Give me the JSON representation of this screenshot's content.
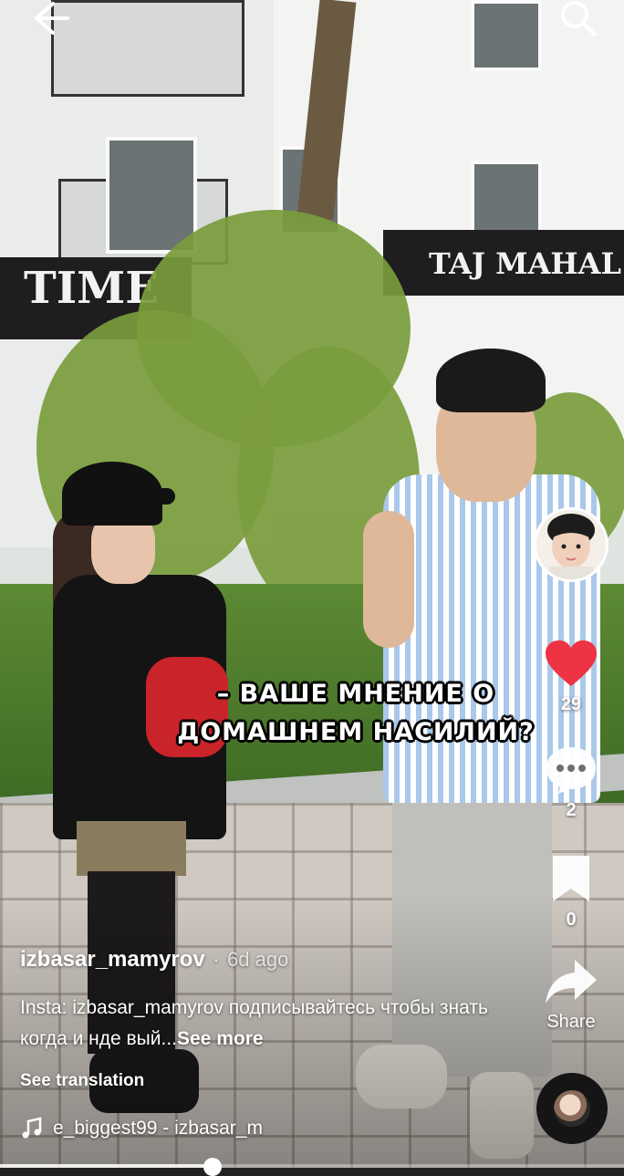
{
  "top_bar": {
    "back_icon": "arrow-left-icon",
    "search_icon": "search-icon"
  },
  "video": {
    "scene_signs": {
      "left": "TIME",
      "right": "TAJ MAHAL"
    },
    "caption": [
      "– ВАШЕ МНЕНИЕ О",
      "ДОМАШНЕМ НАСИЛИЙ?"
    ]
  },
  "actions": {
    "likes": "29",
    "comments": "2",
    "saves": "0",
    "share_label": "Share",
    "like_color": "#ee3345"
  },
  "post": {
    "username": "izbasar_mamyrov",
    "separator": "·",
    "age": "6d ago",
    "description": "Insta: izbasar_mamyrov подписывайтесь чтобы знать когда и нде вый...",
    "see_more": "See more",
    "see_translation": "See translation",
    "music": "e_biggest99 - izbasar_m"
  },
  "playback": {
    "progress": 0.34
  }
}
